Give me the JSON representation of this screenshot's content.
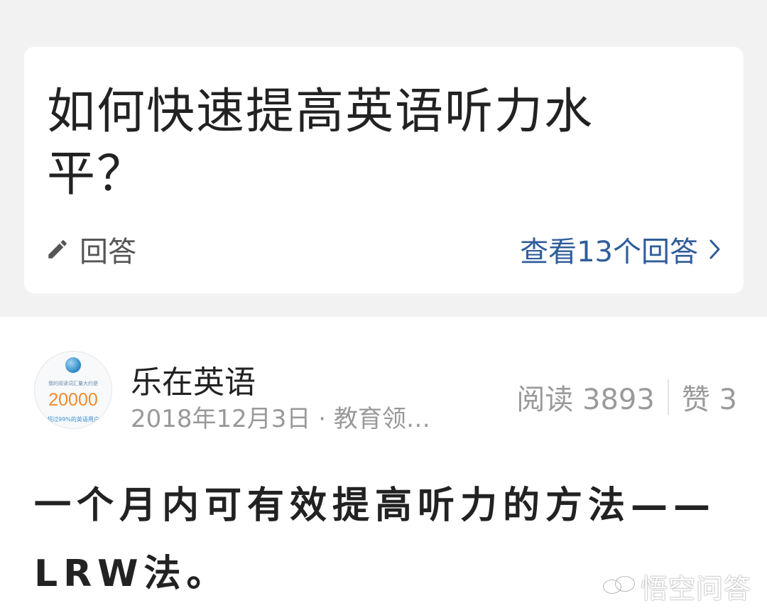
{
  "question": {
    "title": "如何快速提高英语听力水平？",
    "answer_label": "回答",
    "view_answers_label": "查看13个回答"
  },
  "author": {
    "name": "乐在英语",
    "meta": "2018年12月3日 · 教育领…",
    "avatar": {
      "caption": "我的阅读词汇量大约是",
      "number": "20000",
      "footer": "超过99%的英语用户"
    }
  },
  "stats": {
    "reads": "阅读 3893",
    "likes": "赞 3"
  },
  "article": {
    "title": "一个月内可有效提高听力的方法——LRW法。"
  },
  "watermark": {
    "text": "悟空问答",
    "icon": "wukong-logo-icon"
  },
  "icons": {
    "answer": "pencil-icon",
    "view_answers": "chevron-right-icon"
  },
  "colors": {
    "page_background": "#f2f2f2",
    "card_background": "#ffffff",
    "link": "#2f5d9a",
    "title_text": "#222222",
    "meta_text": "#999999"
  }
}
